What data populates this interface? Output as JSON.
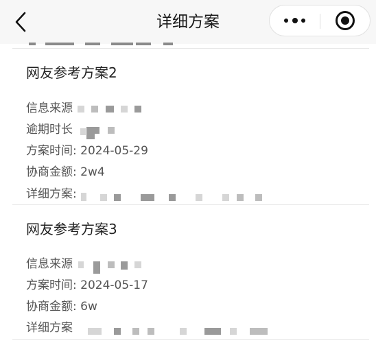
{
  "nav": {
    "title": "详细方案"
  },
  "plans": [
    {
      "title": "网友参考方案2",
      "fields": [
        {
          "label": "信息来源",
          "value": ""
        },
        {
          "label": "逾期时长",
          "value": ""
        },
        {
          "label": "方案时间: 2024-05-29",
          "value": ""
        },
        {
          "label": "协商金额: 2w4",
          "value": ""
        },
        {
          "label": "详细方案:",
          "value": ""
        }
      ]
    },
    {
      "title": "网友参考方案3",
      "fields": [
        {
          "label": "信息来源",
          "value": ""
        },
        {
          "label": "方案时间: 2024-05-17",
          "value": ""
        },
        {
          "label": "协商金额: 6w",
          "value": ""
        },
        {
          "label": "详细方案",
          "value": ""
        }
      ]
    }
  ],
  "icons": {
    "back": "chevron-left-icon",
    "more": "more-dots-icon",
    "close": "target-circle-icon"
  },
  "colors": {
    "nav_background": "#f7f7f7",
    "text": "#555555",
    "title_text": "#222222"
  }
}
